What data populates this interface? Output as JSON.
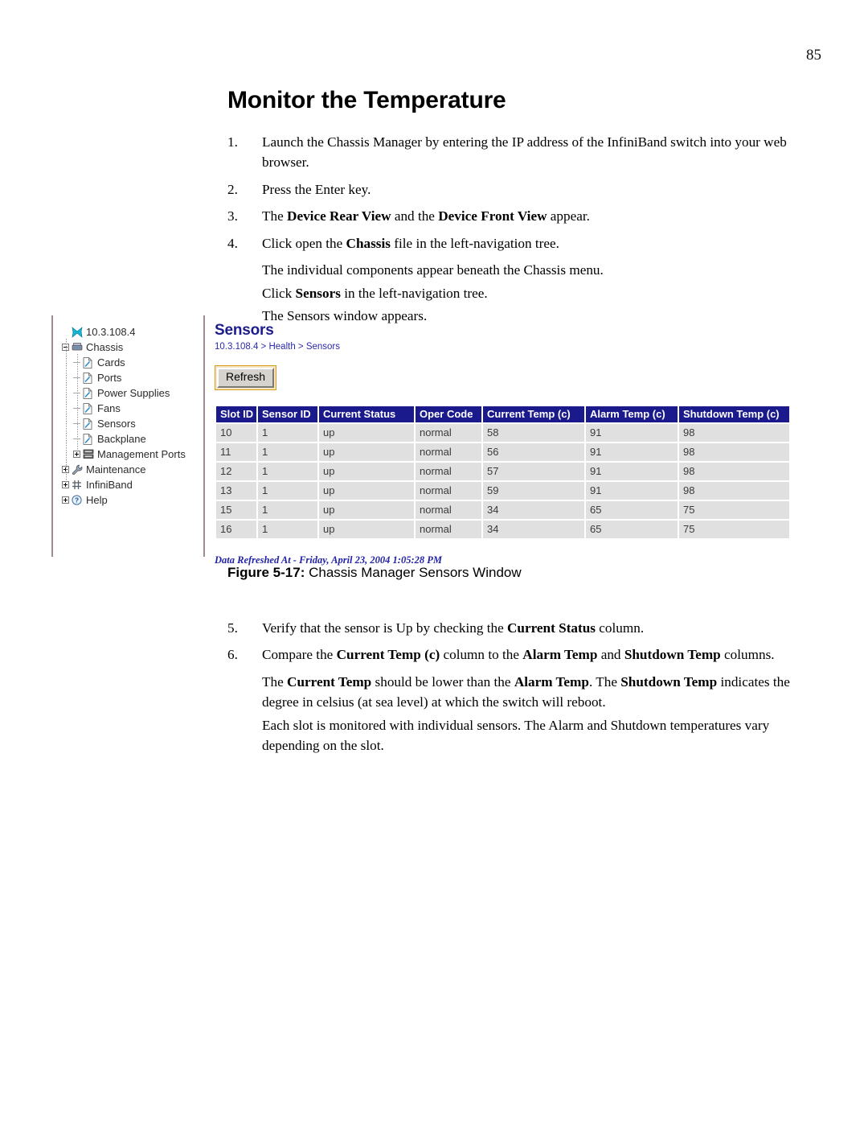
{
  "page": {
    "number": "85",
    "title": "Monitor the Temperature"
  },
  "steps_before": [
    {
      "num": "1.",
      "parts": [
        {
          "t": "Launch the Chassis Manager by entering the IP address of the InfiniBand switch into your web browser.",
          "b": false
        }
      ]
    },
    {
      "num": "2.",
      "parts": [
        {
          "t": "Press the Enter key.",
          "b": false
        }
      ]
    },
    {
      "num": "3.",
      "parts": [
        {
          "t": "The ",
          "b": false
        },
        {
          "t": "Device Rear View",
          "b": true
        },
        {
          "t": " and the ",
          "b": false
        },
        {
          "t": "Device Front View",
          "b": true
        },
        {
          "t": " appear.",
          "b": false
        }
      ]
    },
    {
      "num": "4.",
      "parts": [
        {
          "t": "Click open the ",
          "b": false
        },
        {
          "t": "Chassis",
          "b": true
        },
        {
          "t": " file in the left-navigation tree.",
          "b": false
        }
      ]
    }
  ],
  "substeps_before": [
    {
      "parts": [
        {
          "t": "The individual components appear beneath the Chassis menu.",
          "b": false
        }
      ]
    },
    {
      "parts": [
        {
          "t": "Click ",
          "b": false
        },
        {
          "t": "Sensors",
          "b": true
        },
        {
          "t": " in the left-navigation tree.",
          "b": false
        }
      ]
    },
    {
      "parts": [
        {
          "t": "The Sensors window appears.",
          "b": false
        }
      ]
    }
  ],
  "figure": {
    "caption_label": "Figure 5-17:",
    "caption_text": " Chassis Manager Sensors Window",
    "tree": {
      "items": [
        {
          "label": "10.3.108.4",
          "depth": 0,
          "expander": "none",
          "icon": "host-x-icon",
          "dash": false
        },
        {
          "label": "Chassis",
          "depth": 0,
          "expander": "minus",
          "icon": "chassis-switch-icon",
          "dash": false
        },
        {
          "label": "Cards",
          "depth": 1,
          "expander": "none",
          "icon": "page-document-icon",
          "dash": true
        },
        {
          "label": "Ports",
          "depth": 1,
          "expander": "none",
          "icon": "page-document-icon",
          "dash": true
        },
        {
          "label": "Power Supplies",
          "depth": 1,
          "expander": "none",
          "icon": "page-document-icon",
          "dash": true
        },
        {
          "label": "Fans",
          "depth": 1,
          "expander": "none",
          "icon": "page-document-icon",
          "dash": true
        },
        {
          "label": "Sensors",
          "depth": 1,
          "expander": "none",
          "icon": "page-document-icon",
          "dash": true
        },
        {
          "label": "Backplane",
          "depth": 1,
          "expander": "none",
          "icon": "page-document-icon",
          "dash": true
        },
        {
          "label": "Management Ports",
          "depth": 1,
          "expander": "plus",
          "icon": "management-ports-icon",
          "dash": false
        },
        {
          "label": "Maintenance",
          "depth": 0,
          "expander": "plus",
          "icon": "wrench-icon",
          "dash": false
        },
        {
          "label": "InfiniBand",
          "depth": 0,
          "expander": "plus",
          "icon": "infiniband-grid-icon",
          "dash": false
        },
        {
          "label": "Help",
          "depth": 0,
          "expander": "plus",
          "icon": "help-question-icon",
          "dash": false
        }
      ]
    },
    "panel": {
      "title": "Sensors",
      "breadcrumb": [
        "10.3.108.4",
        "Health",
        "Sensors"
      ],
      "breadcrumb_separator": " > ",
      "refresh_label": "Refresh",
      "refreshed_at": "Data Refreshed At - Friday, April 23, 2004 1:05:28 PM"
    },
    "table": {
      "columns": [
        "Slot ID",
        "Sensor ID",
        "Current Status",
        "Oper Code",
        "Current Temp (c)",
        "Alarm Temp (c)",
        "Shutdown Temp (c)"
      ],
      "rows": [
        [
          "10",
          "1",
          "up",
          "normal",
          "58",
          "91",
          "98"
        ],
        [
          "11",
          "1",
          "up",
          "normal",
          "56",
          "91",
          "98"
        ],
        [
          "12",
          "1",
          "up",
          "normal",
          "57",
          "91",
          "98"
        ],
        [
          "13",
          "1",
          "up",
          "normal",
          "59",
          "91",
          "98"
        ],
        [
          "15",
          "1",
          "up",
          "normal",
          "34",
          "65",
          "75"
        ],
        [
          "16",
          "1",
          "up",
          "normal",
          "34",
          "65",
          "75"
        ]
      ]
    },
    "colors": {
      "header_bg": "#1a1a8c",
      "cell_bg": "#e0e0e0",
      "title_blue": "#1c1c8e",
      "link_blue": "#2b2bb0",
      "button_border": "#d79b19"
    }
  },
  "steps_after": [
    {
      "num": "5.",
      "parts": [
        {
          "t": "Verify that the sensor is Up by checking the ",
          "b": false
        },
        {
          "t": "Current Status",
          "b": true
        },
        {
          "t": " column.",
          "b": false
        }
      ]
    },
    {
      "num": "6.",
      "parts": [
        {
          "t": "Compare the ",
          "b": false
        },
        {
          "t": "Current Temp (c)",
          "b": true
        },
        {
          "t": " column to the ",
          "b": false
        },
        {
          "t": "Alarm Temp",
          "b": true
        },
        {
          "t": " and ",
          "b": false
        },
        {
          "t": "Shutdown Temp",
          "b": true
        },
        {
          "t": " columns.",
          "b": false
        }
      ]
    }
  ],
  "substeps_after": [
    {
      "parts": [
        {
          "t": "The ",
          "b": false
        },
        {
          "t": "Current Temp",
          "b": true
        },
        {
          "t": " should be lower than the ",
          "b": false
        },
        {
          "t": "Alarm Temp",
          "b": true
        },
        {
          "t": ". The ",
          "b": false
        },
        {
          "t": "Shutdown Temp",
          "b": true
        },
        {
          "t": " indicates the degree in celsius (at sea level) at which the switch will reboot.",
          "b": false
        }
      ]
    },
    {
      "parts": [
        {
          "t": "Each slot is monitored with individual sensors. The Alarm and Shutdown temperatures vary depending on the slot.",
          "b": false
        }
      ]
    }
  ]
}
